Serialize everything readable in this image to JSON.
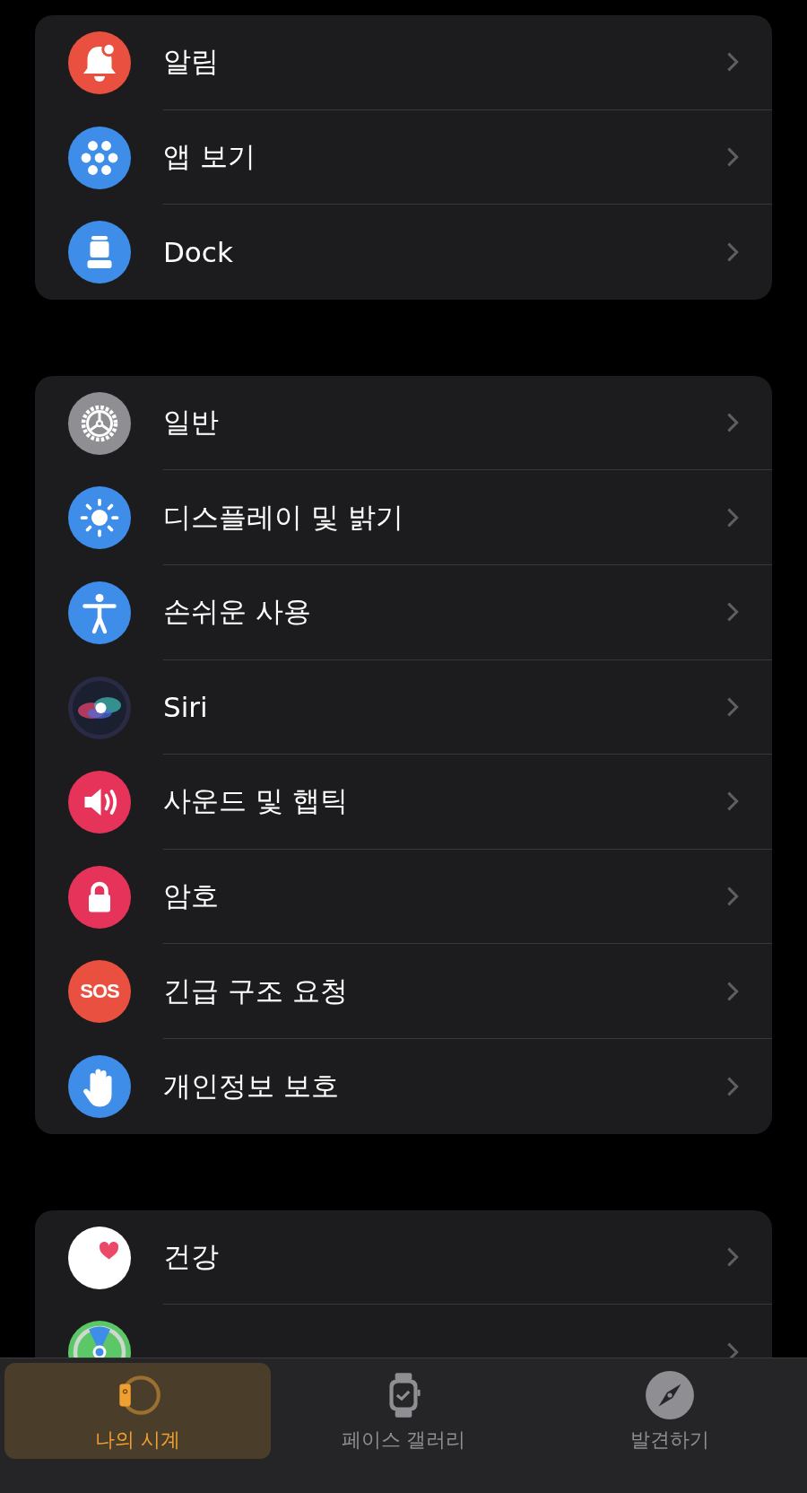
{
  "groups": [
    {
      "items": [
        {
          "label": "알림",
          "kind": "bell",
          "color": "#e9503f"
        },
        {
          "label": "앱 보기",
          "kind": "apps",
          "color": "#3e8ee9"
        },
        {
          "label": "Dock",
          "kind": "dock",
          "color": "#3e8ee9"
        }
      ]
    },
    {
      "items": [
        {
          "label": "일반",
          "kind": "gear",
          "color": "#8e8e93"
        },
        {
          "label": "디스플레이 및 밝기",
          "kind": "sun",
          "color": "#3e8ee9"
        },
        {
          "label": "손쉬운 사용",
          "kind": "person",
          "color": "#3e8ee9"
        },
        {
          "label": "Siri",
          "kind": "orb",
          "color": "#2a2a44"
        },
        {
          "label": "사운드 및 햅틱",
          "kind": "speaker",
          "color": "#e5335a"
        },
        {
          "label": "암호",
          "kind": "lock",
          "color": "#e5335a"
        },
        {
          "label": "긴급 구조 요청",
          "kind": "sos",
          "color": "#e9503f",
          "icon_text": "SOS"
        },
        {
          "label": "개인정보 보호",
          "kind": "hand",
          "color": "#3e8ee9"
        }
      ]
    },
    {
      "items": [
        {
          "label": "건강",
          "kind": "heart",
          "color": "#ffffff"
        },
        {
          "kind": "radar",
          "color": "#5cc766"
        }
      ]
    }
  ],
  "tabs": [
    {
      "label": "나의 시계",
      "kind": "band",
      "selected": true
    },
    {
      "label": "페이스 갤러리",
      "kind": "watch",
      "selected": false
    },
    {
      "label": "발견하기",
      "kind": "compass",
      "selected": false
    }
  ]
}
